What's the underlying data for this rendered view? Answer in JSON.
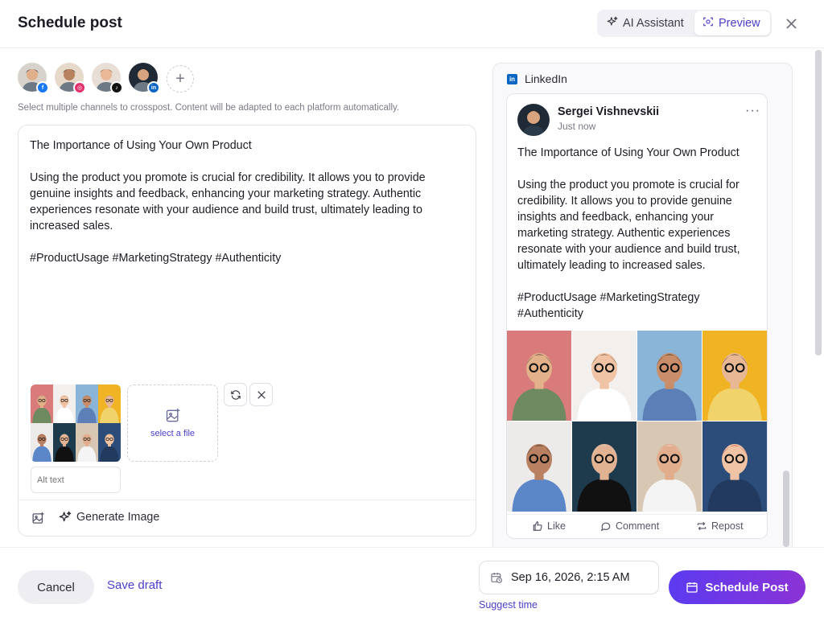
{
  "header": {
    "title": "Schedule post",
    "ai_assistant_label": "AI Assistant",
    "preview_label": "Preview",
    "close_icon": "close-icon"
  },
  "channels": {
    "accounts": [
      {
        "platform": "Facebook",
        "badge_color": "#1877f2",
        "skin": "#e0b08c",
        "hair": "#3b2a20",
        "bg": "#d7d3cc"
      },
      {
        "platform": "Instagram",
        "badge_color": "#e1306c",
        "skin": "#b9825f",
        "hair": "#2b1d16",
        "bg": "#e6d9c9"
      },
      {
        "platform": "TikTok",
        "badge_color": "#111111",
        "skin": "#e9b896",
        "hair": "#9c4b2a",
        "bg": "#e7ded6"
      },
      {
        "platform": "LinkedIn",
        "badge_color": "#0a66c2",
        "skin": "#d8a37f",
        "hair": "#1e1a18",
        "bg": "#1f2a36"
      }
    ],
    "add_label": "+",
    "hint": "Select multiple channels to crosspost. Content will be adapted to each platform automatically."
  },
  "editor": {
    "paragraphs": [
      "The Importance of Using Your Own Product",
      "Using the product you promote is crucial for credibility. It allows you to provide genuine insights and feedback, enhancing your marketing strategy. Authentic experiences resonate with your audience and build trust, ultimately leading to increased sales.",
      "#ProductUsage #MarketingStrategy #Authenticity"
    ],
    "select_file_label": "select a file",
    "alt_placeholder": "Alt text",
    "generate_image_label": "Generate Image"
  },
  "preview": {
    "network": "LinkedIn",
    "author": "Sergei Vishnevskii",
    "time": "Just now",
    "paragraphs": [
      "The Importance of Using Your Own Product",
      "Using the product you promote is crucial for credibility. It allows you to provide genuine insights and feedback, enhancing your marketing strategy. Authentic experiences resonate with your audience and build trust, ultimately leading to increased sales.",
      "#ProductUsage #MarketingStrategy #Authenticity"
    ],
    "like_label": "Like",
    "comment_label": "Comment",
    "repost_label": "Repost",
    "more_label": "···"
  },
  "photos": [
    {
      "bg": "#d97b7b",
      "skin": "#e2b089",
      "hair": "#2f2621",
      "shirt": "#6f8a60",
      "glasses": true
    },
    {
      "bg": "#f2efec",
      "skin": "#efc3a3",
      "hair": "#5a3a28",
      "shirt": "#ffffff",
      "glasses": true
    },
    {
      "bg": "#8ab4d8",
      "skin": "#c98e69",
      "hair": "#2a1d18",
      "shirt": "#5c7fb8",
      "glasses": true
    },
    {
      "bg": "#f0b323",
      "skin": "#e7b893",
      "hair": "#3b2418",
      "shirt": "#f0d36a",
      "glasses": true
    },
    {
      "bg": "#ecebea",
      "skin": "#b98062",
      "hair": "#1d1a18",
      "shirt": "#5b87c9",
      "glasses": true
    },
    {
      "bg": "#1e3a4d",
      "skin": "#e2b393",
      "hair": "#d8d4cf",
      "shirt": "#111111",
      "glasses": true
    },
    {
      "bg": "#d8c7b3",
      "skin": "#e1ad8c",
      "hair": "#e9e6e1",
      "shirt": "#f4f4f4",
      "glasses": true
    },
    {
      "bg": "#2c4c7a",
      "skin": "#efc3a3",
      "hair": "#d43a2f",
      "shirt": "#233a5f",
      "glasses": true
    }
  ],
  "footer": {
    "cancel_label": "Cancel",
    "save_draft_label": "Save draft",
    "date_value": "Sep 16, 2026, 2:15 AM",
    "suggest_label": "Suggest time",
    "schedule_label": "Schedule Post"
  }
}
